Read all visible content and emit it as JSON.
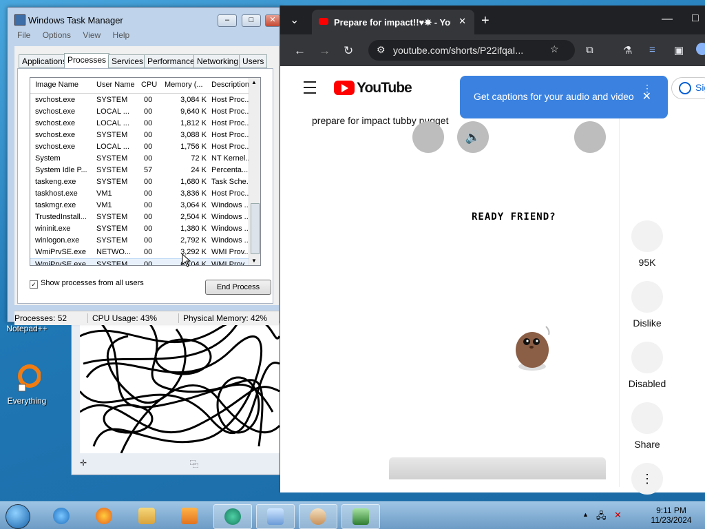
{
  "desktop": {
    "icons": [
      {
        "label": "Notepad++",
        "icon": "notepad-plus-icon"
      },
      {
        "label": "Everything",
        "icon": "everything-search-icon"
      }
    ]
  },
  "task_manager": {
    "title": "Windows Task Manager",
    "menu": [
      "File",
      "Options",
      "View",
      "Help"
    ],
    "tabs": [
      "Applications",
      "Processes",
      "Services",
      "Performance",
      "Networking",
      "Users"
    ],
    "active_tab": "Processes",
    "columns": [
      "Image Name",
      "User Name",
      "CPU",
      "Memory (...",
      "Description"
    ],
    "rows": [
      [
        "svchost.exe",
        "SYSTEM",
        "00",
        "3,084 K",
        "Host Proc..."
      ],
      [
        "svchost.exe",
        "LOCAL ...",
        "00",
        "9,640 K",
        "Host Proc..."
      ],
      [
        "svchost.exe",
        "LOCAL ...",
        "00",
        "1,812 K",
        "Host Proc..."
      ],
      [
        "svchost.exe",
        "SYSTEM",
        "00",
        "3,088 K",
        "Host Proc..."
      ],
      [
        "svchost.exe",
        "LOCAL ...",
        "00",
        "1,756 K",
        "Host Proc..."
      ],
      [
        "System",
        "SYSTEM",
        "00",
        "72 K",
        "NT Kernel..."
      ],
      [
        "System Idle P...",
        "SYSTEM",
        "57",
        "24 K",
        "Percenta..."
      ],
      [
        "taskeng.exe",
        "SYSTEM",
        "00",
        "1,680 K",
        "Task Sche..."
      ],
      [
        "taskhost.exe",
        "VM1",
        "00",
        "3,836 K",
        "Host Proc..."
      ],
      [
        "taskmgr.exe",
        "VM1",
        "00",
        "3,064 K",
        "Windows ..."
      ],
      [
        "TrustedInstall...",
        "SYSTEM",
        "00",
        "2,504 K",
        "Windows ..."
      ],
      [
        "wininit.exe",
        "SYSTEM",
        "00",
        "1,380 K",
        "Windows ..."
      ],
      [
        "winlogon.exe",
        "SYSTEM",
        "00",
        "2,792 K",
        "Windows ..."
      ],
      [
        "WmiPrvSE.exe",
        "NETWO...",
        "00",
        "3,292 K",
        "WMI Prov..."
      ],
      [
        "WmiPrvSE.exe",
        "SYSTEM",
        "00",
        "6,104 K",
        "WMI Prov..."
      ]
    ],
    "show_all_label": "Show processes from all users",
    "show_all_checked": "✓",
    "end_process_label": "End Process",
    "status": {
      "processes": "Processes: 52",
      "cpu": "CPU Usage: 43%",
      "memory": "Physical Memory: 42%"
    },
    "window_buttons": {
      "minimize": "–",
      "maximize": "□",
      "close": "✕"
    }
  },
  "browser": {
    "tab_title": "Prepare for impact!!♥✵ - YouTube",
    "tab_close": "✕",
    "new_tab": "+",
    "url": "youtube.com/shorts/P22ifqaI...",
    "nav": {
      "back": "←",
      "forward": "→",
      "reload": "↻",
      "tab_list": "⌄"
    },
    "window_buttons": {
      "minimize": "—",
      "maximize": "□"
    }
  },
  "youtube": {
    "logo_text": "YouTube",
    "tooltip_text": "Get captions for your audio and video",
    "tooltip_close": "✕",
    "tooltip_more": "⋮",
    "sign_in": "Sig",
    "short_title": "prepare for impact tubby nugget",
    "video_text": "READY FRIEND?",
    "mute_glyph": "🔊",
    "actions": [
      {
        "label": "95K",
        "icon": "like-icon"
      },
      {
        "label": "Dislike",
        "icon": "dislike-icon"
      },
      {
        "label": "Disabled",
        "icon": "comments-icon"
      },
      {
        "label": "Share",
        "icon": "share-icon"
      }
    ],
    "more_glyph": "⋮"
  },
  "taskbar": {
    "time": "9:11 PM",
    "date": "11/23/2024",
    "tray_arrow": "▲"
  }
}
